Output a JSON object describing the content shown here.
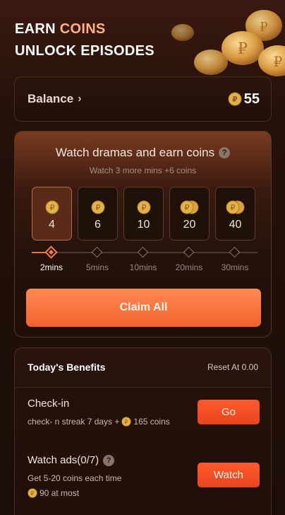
{
  "header": {
    "title_line1_a": "EARN ",
    "title_line1_b": "COINS",
    "title_line2": "UNLOCK EPISODES"
  },
  "balance": {
    "label": "Balance",
    "value": "55"
  },
  "watch": {
    "title": "Watch dramas and earn coins",
    "subtitle": "Watch 3 more mins +6 coins",
    "tiers": [
      {
        "value": "4",
        "label": "2mins",
        "coin_stack": 1
      },
      {
        "value": "6",
        "label": "5mins",
        "coin_stack": 1
      },
      {
        "value": "10",
        "label": "10mins",
        "coin_stack": 1
      },
      {
        "value": "20",
        "label": "20mins",
        "coin_stack": 2
      },
      {
        "value": "40",
        "label": "30mins",
        "coin_stack": 2
      }
    ],
    "claim_label": "Claim All"
  },
  "benefits": {
    "title": "Today's Benefits",
    "reset": "Reset At 0.00",
    "tasks": [
      {
        "title": "Check-in",
        "desc_a": "check- n streak 7 days +",
        "desc_b": "165 coins",
        "button": "Go"
      },
      {
        "title": "Watch ads(0/7)",
        "desc_a": "Get 5-20 coins each time",
        "desc_b": "90 at most",
        "button": "Watch"
      }
    ]
  },
  "colors": {
    "accent": "#f36230",
    "coin_gold": "#e2b24a",
    "title_accent": "#ffb08a"
  }
}
